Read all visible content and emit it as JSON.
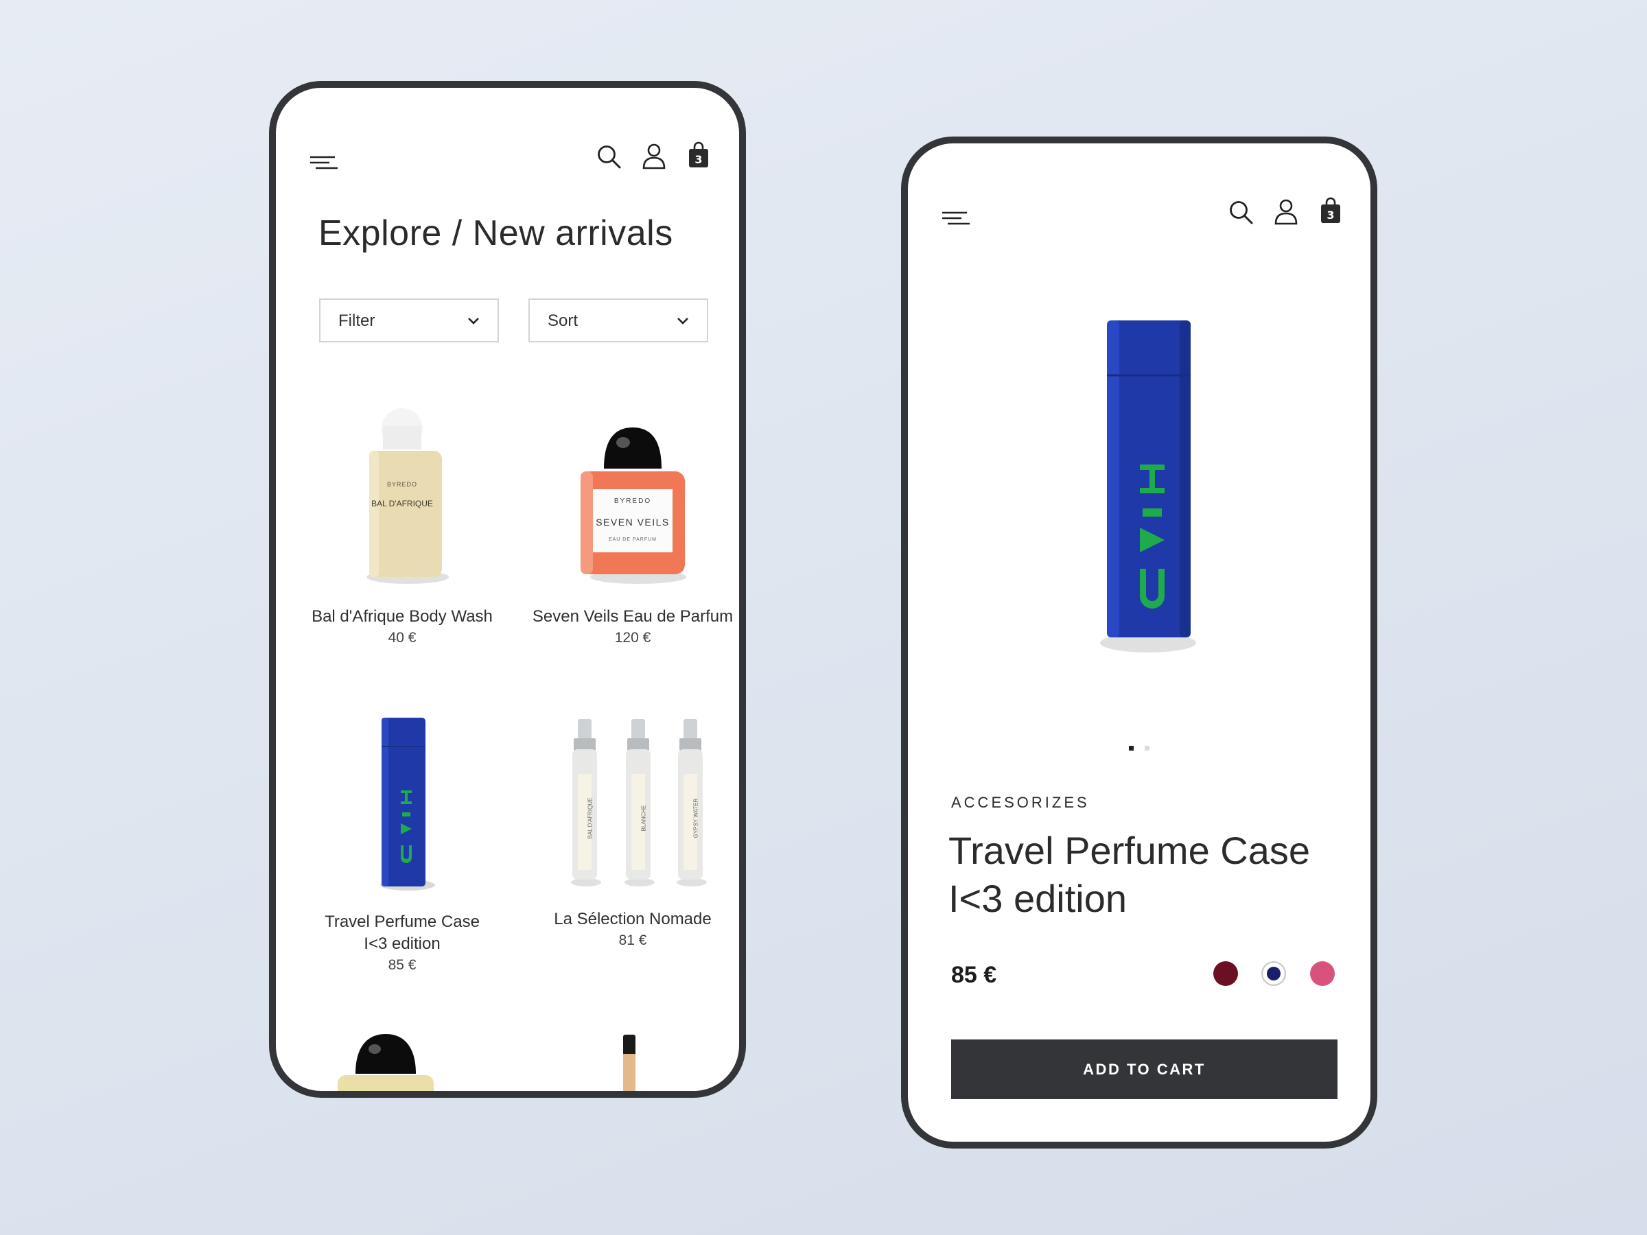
{
  "listing": {
    "title": "Explore / New arrivals",
    "cart_count": "3",
    "filter_label": "Filter",
    "sort_label": "Sort",
    "products": [
      {
        "name": "Bal d'Afrique Body Wash",
        "price": "40 €",
        "label_brand": "BYREDO",
        "label_text": "BAL D'AFRIQUE"
      },
      {
        "name": "Seven Veils Eau de Parfum",
        "price": "120 €",
        "label_brand": "BYREDO",
        "label_text": "SEVEN VEILS",
        "label_sub": "EAU DE PARFUM"
      },
      {
        "name_line1": "Travel Perfume Case",
        "name_line2": "I<3 edition",
        "price": "85 €"
      },
      {
        "name": "La Sélection Nomade",
        "price": "81 €",
        "vial_labels": [
          "BAL D'AFRIQUE",
          "BLANCHE",
          "GYPSY WATER"
        ]
      }
    ]
  },
  "detail": {
    "cart_count": "3",
    "category": "ACCESORIZES",
    "title_line1": "Travel Perfume Case",
    "title_line2": "I<3 edition",
    "price": "85 €",
    "swatches": [
      "#6b0f24",
      "#1b1e6b",
      "#d9527c"
    ],
    "cta_label": "ADD TO CART",
    "carousel_active": 1,
    "carousel_total": 2
  },
  "colors": {
    "frame": "#333538",
    "case_blue": "#1f3aa8",
    "case_green": "#1faa4c"
  }
}
